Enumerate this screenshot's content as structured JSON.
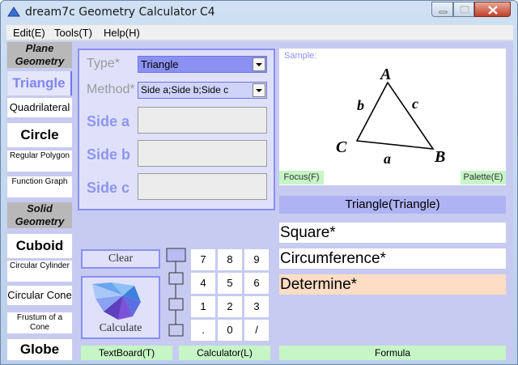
{
  "window": {
    "title": "dream7c Geometry Calculator C4"
  },
  "menu": {
    "edit": "Edit(E)",
    "tools": "Tools(T)",
    "help": "Help(H)"
  },
  "nav": {
    "plane_heading": "Plane Geometry",
    "solid_heading": "Solid Geometry",
    "triangle": "Triangle",
    "quadrilateral": "Quadrilateral",
    "circle": "Circle",
    "regular_polygon": "Regular Polygon",
    "function_graph": "Function Graph",
    "cuboid": "Cuboid",
    "circular_cylinder": "Circular Cylinder",
    "circular_cone": "Circular Cone",
    "frustum_of_a_cone": "Frustum of a Cone",
    "globe": "Globe"
  },
  "form": {
    "type_label": "Type*",
    "type_value": "Triangle",
    "method_label": "Method*",
    "method_value": "Side a;Side b;Side c",
    "side_a_label": "Side a",
    "side_b_label": "Side b",
    "side_c_label": "Side c",
    "side_a_value": "",
    "side_b_value": "",
    "side_c_value": ""
  },
  "sample": {
    "label": "Sample:",
    "vertex_a": "A",
    "vertex_b": "B",
    "vertex_c": "C",
    "side_a": "a",
    "side_b": "b",
    "side_c": "c",
    "focus_button": "Focus(F)",
    "palette_button": "Palette(E)"
  },
  "results": {
    "title": "Triangle(Triangle)",
    "items": [
      "Square*",
      "Circumference*",
      "Determine*"
    ]
  },
  "actions": {
    "clear": "Clear",
    "calculate": "Calculate"
  },
  "keypad": {
    "keys": [
      "7",
      "8",
      "9",
      "4",
      "5",
      "6",
      "1",
      "2",
      "3",
      ".",
      "0",
      "/"
    ]
  },
  "bottom_tabs": {
    "textboard": "TextBoard(T)",
    "calculator": "Calculator(L)",
    "formula": "Formula"
  },
  "colors": {
    "accent": "#8a8ff0",
    "selection": "#aeb3f3",
    "highlight_result": "#fdddc4",
    "tab_green": "#c6f5c6"
  }
}
